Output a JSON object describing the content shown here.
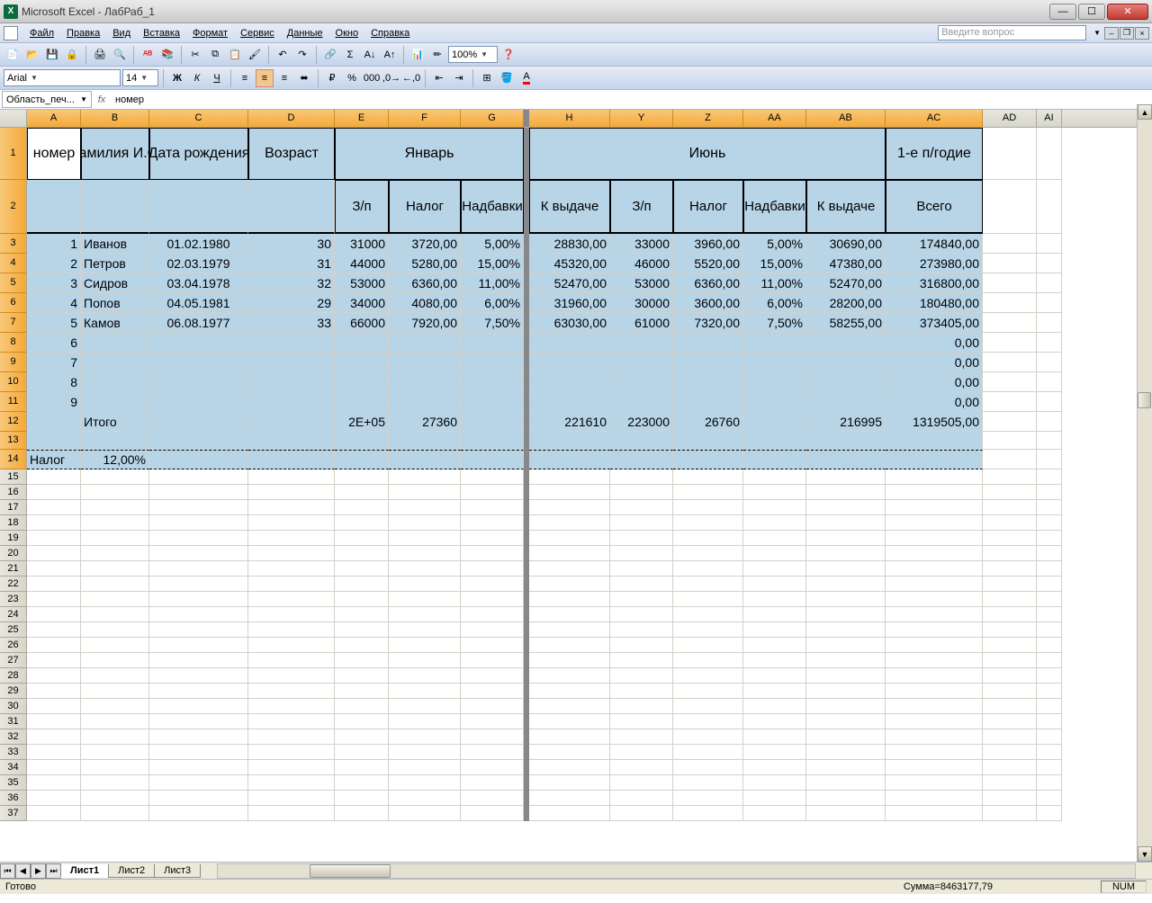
{
  "app_title": "Microsoft Excel - ЛабРаб_1",
  "menus": [
    "Файл",
    "Правка",
    "Вид",
    "Вставка",
    "Формат",
    "Сервис",
    "Данные",
    "Окно",
    "Справка"
  ],
  "help_placeholder": "Введите вопрос",
  "font_name": "Arial",
  "font_size": "14",
  "zoom": "100%",
  "name_box": "Область_печ...",
  "formula": "номер",
  "col_labels": [
    "A",
    "B",
    "C",
    "D",
    "E",
    "F",
    "G",
    "H",
    "Y",
    "Z",
    "AA",
    "AB",
    "AC",
    "AD",
    "AI"
  ],
  "headers": {
    "nomer": "номер",
    "fio": "Фамилия И.О.",
    "dob": "Дата рождения",
    "age": "Возраст",
    "jan": "Январь",
    "jun": "Июнь",
    "half": "1-е п/годие",
    "zp": "З/п",
    "nalog": "Налог",
    "nadbavki": "Надбавки",
    "k_vid": "К выдаче",
    "vsego": "Всего"
  },
  "rows": [
    {
      "n": "1",
      "fio": "Иванов",
      "dob": "01.02.1980",
      "age": "30",
      "e": "31000",
      "f": "3720,00",
      "g": "5,00%",
      "h": "28830,00",
      "y": "33000",
      "z": "3960,00",
      "aa": "5,00%",
      "ab": "30690,00",
      "ac": "174840,00"
    },
    {
      "n": "2",
      "fio": "Петров",
      "dob": "02.03.1979",
      "age": "31",
      "e": "44000",
      "f": "5280,00",
      "g": "15,00%",
      "h": "45320,00",
      "y": "46000",
      "z": "5520,00",
      "aa": "15,00%",
      "ab": "47380,00",
      "ac": "273980,00"
    },
    {
      "n": "3",
      "fio": "Сидров",
      "dob": "03.04.1978",
      "age": "32",
      "e": "53000",
      "f": "6360,00",
      "g": "11,00%",
      "h": "52470,00",
      "y": "53000",
      "z": "6360,00",
      "aa": "11,00%",
      "ab": "52470,00",
      "ac": "316800,00"
    },
    {
      "n": "4",
      "fio": "Попов",
      "dob": "04.05.1981",
      "age": "29",
      "e": "34000",
      "f": "4080,00",
      "g": "6,00%",
      "h": "31960,00",
      "y": "30000",
      "z": "3600,00",
      "aa": "6,00%",
      "ab": "28200,00",
      "ac": "180480,00"
    },
    {
      "n": "5",
      "fio": "Камов",
      "dob": "06.08.1977",
      "age": "33",
      "e": "66000",
      "f": "7920,00",
      "g": "7,50%",
      "h": "63030,00",
      "y": "61000",
      "z": "7320,00",
      "aa": "7,50%",
      "ab": "58255,00",
      "ac": "373405,00"
    },
    {
      "n": "6",
      "ac": "0,00"
    },
    {
      "n": "7",
      "ac": "0,00"
    },
    {
      "n": "8",
      "ac": "0,00"
    },
    {
      "n": "9",
      "ac": "0,00"
    }
  ],
  "totals": {
    "label": "Итого",
    "e": "2E+05",
    "f": "27360",
    "h": "221610",
    "y": "223000",
    "z": "26760",
    "ab": "216995",
    "ac": "1319505,00"
  },
  "nalog_row": {
    "label": "Налог",
    "val": "12,00%"
  },
  "sheets": [
    "Лист1",
    "Лист2",
    "Лист3"
  ],
  "status_ready": "Готово",
  "status_sum": "Сумма=8463177,79",
  "status_num": "NUM"
}
